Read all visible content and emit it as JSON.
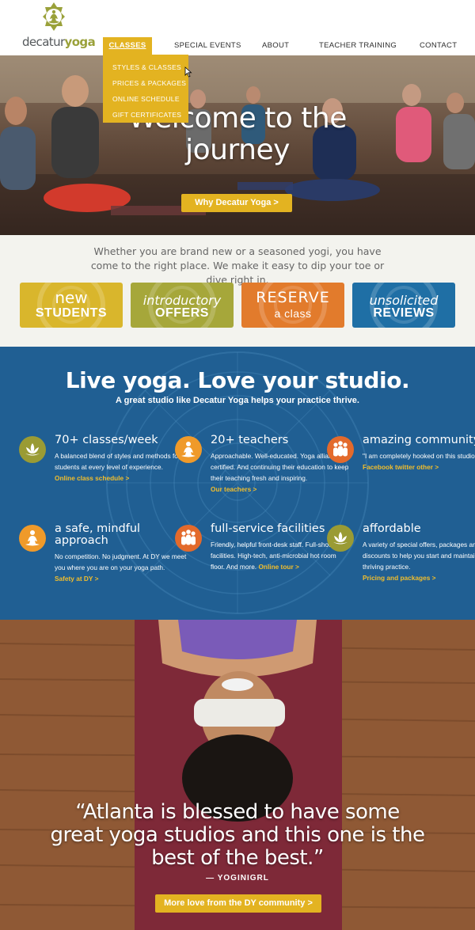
{
  "brand": {
    "name_light": "decatur",
    "name_bold": "yoga"
  },
  "nav": {
    "items": [
      "CLASSES",
      "SPECIAL EVENTS",
      "ABOUT",
      "TEACHER TRAINING",
      "CONTACT"
    ],
    "active": "CLASSES",
    "dropdown": [
      "STYLES & CLASSES",
      "PRICES & PACKAGES",
      "ONLINE SCHEDULE",
      "GIFT CERTIFICATES"
    ]
  },
  "hero": {
    "title_line1": "Welcome to the",
    "title_line2": "journey",
    "button": "Why Decatur Yoga >"
  },
  "intro": {
    "text": "Whether you are brand new or a seasoned yogi, you have come to the right place. We make it easy to dip your toe or dive right in.",
    "tiles": [
      {
        "line1": "new",
        "line2": "STUDENTS"
      },
      {
        "line1": "introductory",
        "line2": "OFFERS"
      },
      {
        "line1": "RESERVE",
        "line2": "a class"
      },
      {
        "line1": "unsolicited",
        "line2": "REVIEWS"
      }
    ]
  },
  "features": {
    "title": "Live yoga. Love your studio.",
    "subtitle": "A great studio like Decatur Yoga helps your practice thrive.",
    "items": [
      {
        "heading": "70+ classes/week",
        "text": "A balanced blend of styles and methods for students at every level of experience.",
        "link": "Online class schedule >",
        "icon": "lotus-icon"
      },
      {
        "heading": "20+ teachers",
        "text": "Approachable. Well-educated. Yoga alliance certified. And continuing their education to keep their teaching fresh and inspiring.",
        "link": "Our teachers >",
        "icon": "meditation-icon"
      },
      {
        "heading": "amazing community",
        "text": "\"I am completely hooked on this studio...\"",
        "link": "Facebook twitter other >",
        "icon": "community-icon"
      },
      {
        "heading": "a safe, mindful approach",
        "text": "No competition. No judgment. At DY we meet you where you are on your yoga path.",
        "link": "Safety at DY >",
        "icon": "meditation-icon"
      },
      {
        "heading": "full-service facilities",
        "text": "Friendly, helpful front-desk staff. Full-shower facilities. High-tech, anti-microbial hot room floor. And more.",
        "link": "Online tour >",
        "icon": "community-icon"
      },
      {
        "heading": "affordable",
        "text": "A variety of special offers, packages and discounts to help you start and maintain a thriving practice.",
        "link": "Pricing and packages >",
        "icon": "lotus-icon"
      }
    ]
  },
  "testimonial": {
    "quote": "“Atlanta is blessed to have some great yoga studios and this one is the best of the best.”",
    "author": "— YOGINIGRL",
    "button": "More love from the DY community >"
  },
  "colors": {
    "accent": "#e3b321",
    "blue": "#205f93",
    "olive": "#9a9b34",
    "orange": "#e27b2c"
  }
}
